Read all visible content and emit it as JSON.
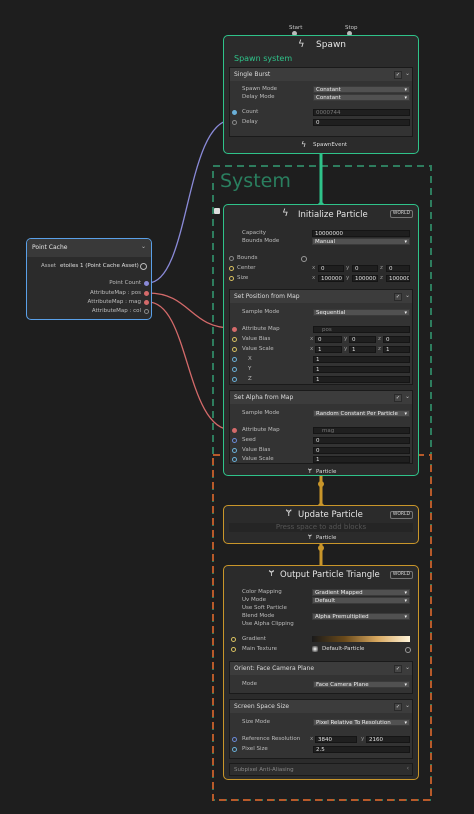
{
  "point_cache": {
    "title": "Point Cache",
    "asset_label": "Asset",
    "asset_value": "etoiles 1 (Point Cache Asset)",
    "outputs": [
      "Point Count",
      "AttributeMap : pos",
      "AttributeMap : mag",
      "AttributeMap : col"
    ]
  },
  "spawn": {
    "start_label": "Start",
    "stop_label": "Stop",
    "title": "Spawn",
    "system_name": "Spawn system",
    "block_title": "Single Burst",
    "spawn_mode_label": "Spawn Mode",
    "spawn_mode_value": "Constant",
    "delay_mode_label": "Delay Mode",
    "delay_mode_value": "Constant",
    "count_label": "Count",
    "count_value": "0000744",
    "delay_label": "Delay",
    "delay_value": "0",
    "event_label": "SpawnEvent"
  },
  "system": {
    "title": "System"
  },
  "initialize": {
    "title": "Initialize Particle",
    "space": "WORLD",
    "capacity_label": "Capacity",
    "capacity_value": "10000000",
    "bounds_mode_label": "Bounds Mode",
    "bounds_mode_value": "Manual",
    "bounds_label": "Bounds",
    "center_label": "Center",
    "size_label": "Size",
    "center": [
      "0",
      "0",
      "0"
    ],
    "size": [
      "100000",
      "100000",
      "100000"
    ],
    "axes": [
      "x",
      "y",
      "z"
    ],
    "block1_title": "Set Position from Map",
    "sample_mode_label": "Sample Mode",
    "block1_sample_mode": "Sequential",
    "attribute_map_label": "Attribute Map",
    "block1_attr_map": "pos",
    "value_bias_label": "Value Bias",
    "value_scale_label": "Value Scale",
    "block1_bias": [
      "0",
      "0",
      "0"
    ],
    "block1_scale": [
      "1",
      "1",
      "1"
    ],
    "x_label": "X",
    "y_label": "Y",
    "z_label": "Z",
    "block1_xyz": [
      "1",
      "1",
      "1"
    ],
    "block2_title": "Set Alpha from Map",
    "block2_sample_mode": "Random Constant Per Particle",
    "block2_attr_map": "mag",
    "seed_label": "Seed",
    "block2_seed": "0",
    "block2_bias": "0",
    "block2_scale": "1",
    "flow_label": "Particle"
  },
  "update": {
    "title": "Update Particle",
    "space": "WORLD",
    "placeholder": "Press space to add blocks",
    "flow_label": "Particle"
  },
  "output": {
    "title": "Output Particle Triangle",
    "space": "WORLD",
    "color_mapping_label": "Color Mapping",
    "color_mapping_value": "Gradient Mapped",
    "uv_mode_label": "Uv Mode",
    "uv_mode_value": "Default",
    "soft_particle_label": "Use Soft Particle",
    "blend_mode_label": "Blend Mode",
    "blend_mode_value": "Alpha Premultiplied",
    "alpha_clipping_label": "Use Alpha Clipping",
    "gradient_label": "Gradient",
    "main_texture_label": "Main Texture",
    "main_texture_value": "Default-Particle",
    "orient_title": "Orient: Face Camera Plane",
    "mode_label": "Mode",
    "mode_value": "Face Camera Plane",
    "sss_title": "Screen Space Size",
    "size_mode_label": "Size Mode",
    "size_mode_value": "Pixel Relative To Resolution",
    "ref_res_label": "Reference Resolution",
    "ref_res": [
      "3840",
      "2160"
    ],
    "pixel_size_label": "Pixel Size",
    "pixel_size_value": "2.5",
    "subpixel_label": "Subpixel Anti-Aliasing"
  },
  "colors": {
    "spawn_green": "#2fc38a",
    "system_green": "#2e7d5e",
    "update_orange": "#c9962a",
    "system_orange": "#b85a2a",
    "link_blue": "#8a8ad8",
    "link_red": "#d46a6a"
  }
}
